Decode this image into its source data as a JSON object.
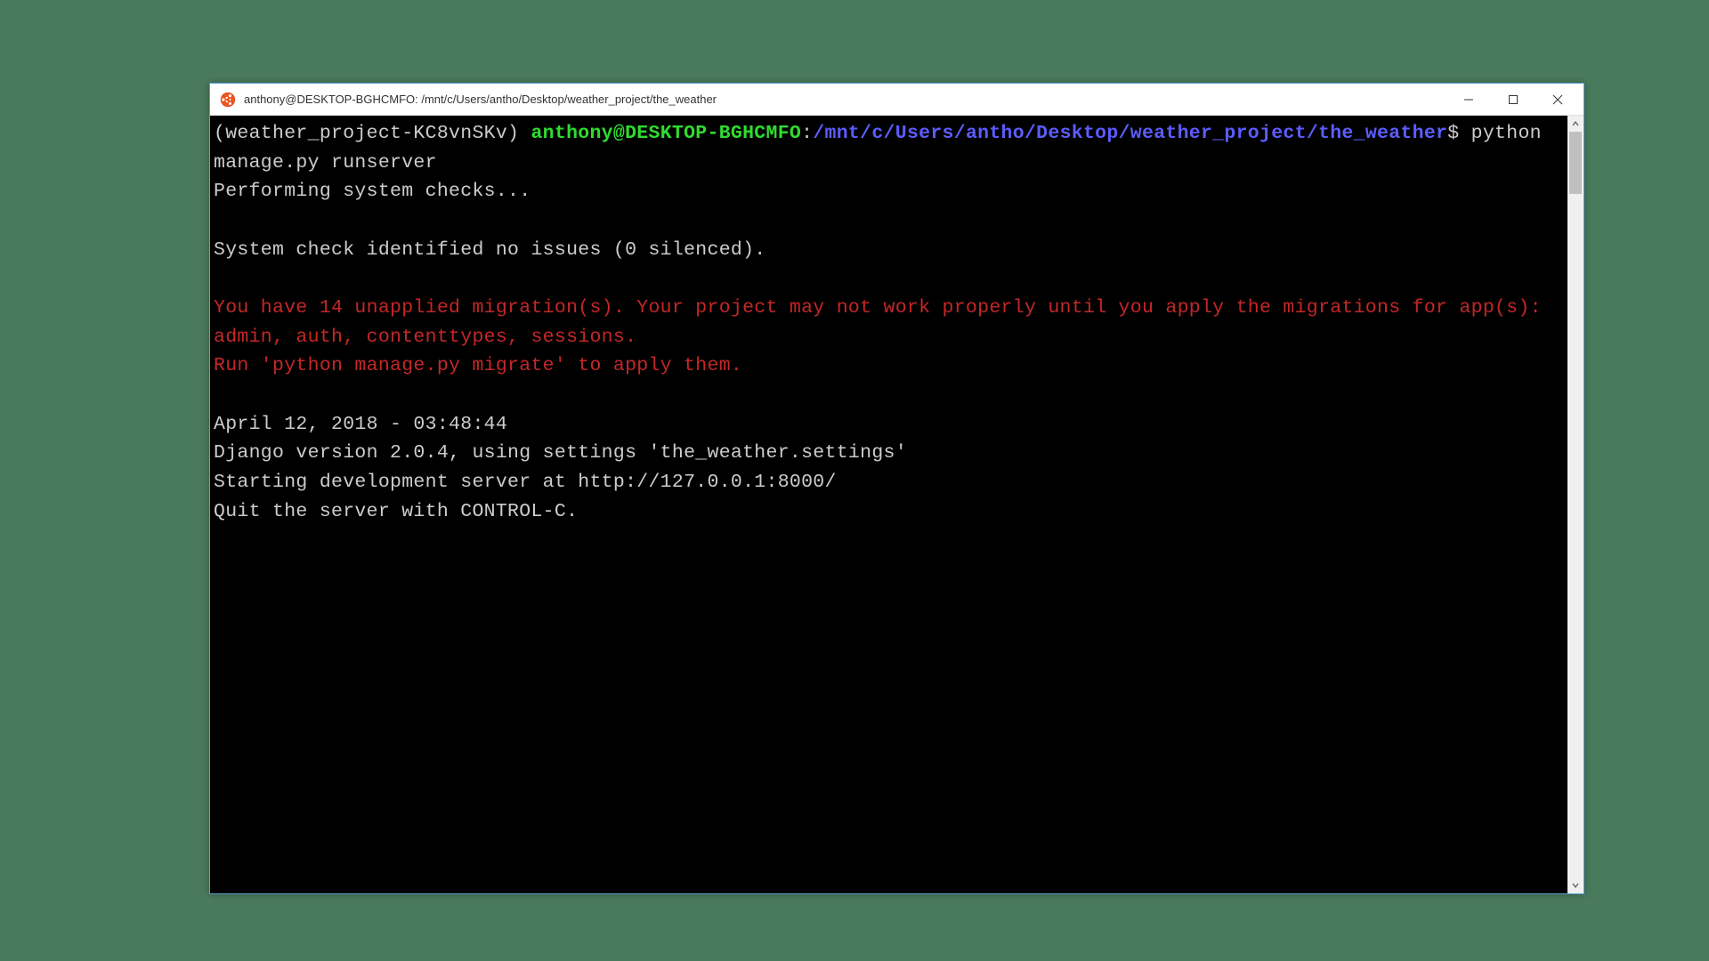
{
  "titlebar": {
    "title": "anthony@DESKTOP-BGHCMFO: /mnt/c/Users/antho/Desktop/weather_project/the_weather"
  },
  "prompt": {
    "venv": "(weather_project-KC8vnSKv) ",
    "user_host": "anthony@DESKTOP-BGHCMFO",
    "colon": ":",
    "path": "/mnt/c/Users/antho/Desktop/weather_project/the_weather",
    "dollar": "$ "
  },
  "command": "python manage.py runserver",
  "output": {
    "line1": "Performing system checks...",
    "blank1": "",
    "line2": "System check identified no issues (0 silenced).",
    "blank2": "",
    "warn1": "You have 14 unapplied migration(s). Your project may not work properly until you apply the migrations for app(s): admin, auth, contenttypes, sessions.",
    "warn2": "Run 'python manage.py migrate' to apply them.",
    "blank3": "",
    "line3": "April 12, 2018 - 03:48:44",
    "line4": "Django version 2.0.4, using settings 'the_weather.settings'",
    "line5": "Starting development server at http://127.0.0.1:8000/",
    "line6": "Quit the server with CONTROL-C."
  }
}
